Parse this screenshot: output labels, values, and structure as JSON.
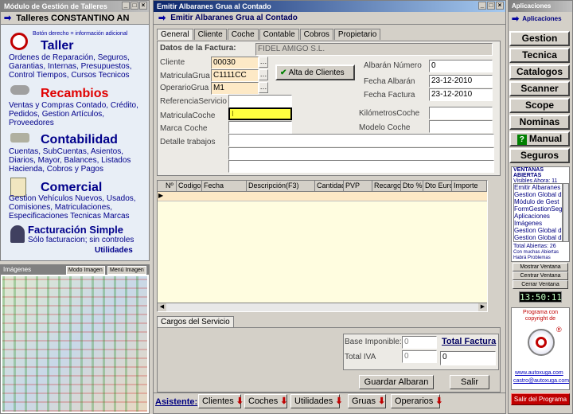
{
  "left_panel": {
    "title": "Módulo de Gestión de Talleres",
    "header": "Talleres CONSTANTINO AN",
    "hint": "Botón derecho = información adicional",
    "sections": [
      {
        "title": "Taller",
        "text": "Ordenes de Reparación, Seguros, Garantias, Internas, Presupuestos, Control Tiempos, Cursos Tecnicos"
      },
      {
        "title": "Recambios",
        "text": "Ventas y Compras Contado, Crédito, Pedidos,  Gestion Artículos, Proveedores"
      },
      {
        "title": "Contabilidad",
        "text": "Cuentas, SubCuentas, Asientos, Diarios, Mayor, Balances, Listados Hacienda, Cobros y Pagos"
      },
      {
        "title": "Comercial",
        "text": "Gestion Vehículos Nuevos, Usados, Comisiones, Matriculaciones, Especificaciones Tecnicas Marcas"
      },
      {
        "title": "Facturación Simple",
        "text": "Sólo facturacion; sin controles"
      }
    ],
    "utilidades": "Utilidades"
  },
  "images_panel": {
    "title": "Imágenes",
    "mode_label": "Modo Imagen",
    "menu_label": "Menú Imagen"
  },
  "main": {
    "window_title": "Emitir Albaranes Grua al Contado",
    "header": "Emitir Albaranes Grua al Contado",
    "tabs": [
      "General",
      "Cliente",
      "Coche",
      "Contable",
      "Cobros",
      "Propietario"
    ],
    "datos_factura_label": "Datos de la Factura:",
    "cliente_name": "FIDEL AMIGO S.L.",
    "labels": {
      "cliente": "Cliente",
      "matricula_grua": "MatriculaGrua",
      "operario_grua": "OperarioGrua",
      "referencia_servicio": "ReferenciaServicio",
      "matricula_coche": "MatriculaCoche",
      "marca_coche": "Marca Coche",
      "detalle_trabajos": "Detalle trabajos",
      "albaran_numero": "Albarán Número",
      "fecha_albaran": "Fecha Albarán",
      "fecha_factura": "Fecha Factura",
      "kilometros_coche": "KilómetrosCoche",
      "modelo_coche": "Modelo Coche"
    },
    "values": {
      "cliente": "00030",
      "matricula_grua": "C1111CC",
      "operario_grua": "M1",
      "albaran_numero": "0",
      "fecha_albaran": "23-12-2010",
      "fecha_factura": "23-12-2010"
    },
    "alta_clientes": "Alta de Clientes",
    "grid_columns": [
      "Nº",
      "Codigo",
      "Fecha",
      "Descripción(F3)",
      "Cantidad",
      "PVP",
      "Recargo",
      "Dto %",
      "Dto Euro",
      "Importe"
    ],
    "cargos_tab": "Cargos del Servicio",
    "base_imponible_label": "Base Imponible:",
    "base_imponible": "0",
    "total_iva_label": "Total IVA",
    "total_iva": "0",
    "total_factura_label": "Total Factura",
    "total_factura": "0",
    "guardar": "Guardar Albaran",
    "salir": "Salir"
  },
  "assistant": {
    "label": "Asistente:",
    "buttons": [
      "Clientes",
      "Coches",
      "Utilidades",
      "Gruas",
      "Operarios"
    ]
  },
  "right_panel": {
    "title": "Aplicaciones",
    "header": "Aplicaciones",
    "nav": [
      "Gestion",
      "Tecnica",
      "Catalogos",
      "Scanner",
      "Scope",
      "Nominas",
      "Manual",
      "Seguros"
    ],
    "ventanas_title": "VENTANAS ABIERTAS",
    "visibles": "Visibles Ahora: 11",
    "ventanas": [
      "Emitir Albaranes",
      "Gestion Global d",
      "Módulo de Gest",
      "FormGestionSeg",
      "Aplicaciones",
      "Imágenes",
      "Gestion Global d",
      "Gestion Global d"
    ],
    "total_abiertas": "Total Abiertas: 26",
    "problemas": "Con muchas Abiertas Habrá Problemas",
    "btn_mostrar": "Mostrar Ventana",
    "btn_centrar": "Centrar Ventana",
    "btn_cerrar": "Cerrar Ventana",
    "clock": "13:50:11",
    "programa": "Programa con copyright de",
    "web": "www.autoxuga.com",
    "email": "castro@autoxuga.com",
    "salir_programa": "Salir del Programa",
    "colors": {
      "accent_red": "#c00000",
      "nav_blue": "#0000c0",
      "clock_bg": "#000000"
    }
  }
}
